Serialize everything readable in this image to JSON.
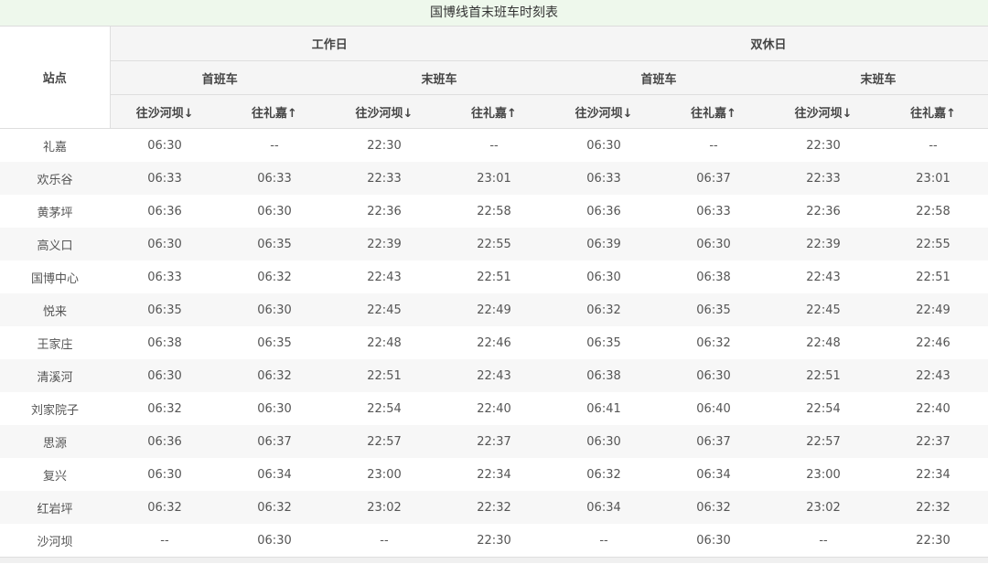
{
  "title": "国博线首末班车时刻表",
  "header": {
    "station": "站点",
    "day_groups": [
      "工作日",
      "双休日"
    ],
    "train_groups": [
      "首班车",
      "末班车",
      "首班车",
      "末班车"
    ],
    "directions": [
      "往沙河坝↓",
      "往礼嘉↑",
      "往沙河坝↓",
      "往礼嘉↑",
      "往沙河坝↓",
      "往礼嘉↑",
      "往沙河坝↓",
      "往礼嘉↑"
    ]
  },
  "rows": [
    {
      "station": "礼嘉",
      "times": [
        "06:30",
        "--",
        "22:30",
        "--",
        "06:30",
        "--",
        "22:30",
        "--"
      ]
    },
    {
      "station": "欢乐谷",
      "times": [
        "06:33",
        "06:33",
        "22:33",
        "23:01",
        "06:33",
        "06:37",
        "22:33",
        "23:01"
      ]
    },
    {
      "station": "黄茅坪",
      "times": [
        "06:36",
        "06:30",
        "22:36",
        "22:58",
        "06:36",
        "06:33",
        "22:36",
        "22:58"
      ]
    },
    {
      "station": "高义口",
      "times": [
        "06:30",
        "06:35",
        "22:39",
        "22:55",
        "06:39",
        "06:30",
        "22:39",
        "22:55"
      ]
    },
    {
      "station": "国博中心",
      "times": [
        "06:33",
        "06:32",
        "22:43",
        "22:51",
        "06:30",
        "06:38",
        "22:43",
        "22:51"
      ]
    },
    {
      "station": "悦来",
      "times": [
        "06:35",
        "06:30",
        "22:45",
        "22:49",
        "06:32",
        "06:35",
        "22:45",
        "22:49"
      ]
    },
    {
      "station": "王家庄",
      "times": [
        "06:38",
        "06:35",
        "22:48",
        "22:46",
        "06:35",
        "06:32",
        "22:48",
        "22:46"
      ]
    },
    {
      "station": "清溪河",
      "times": [
        "06:30",
        "06:32",
        "22:51",
        "22:43",
        "06:38",
        "06:30",
        "22:51",
        "22:43"
      ]
    },
    {
      "station": "刘家院子",
      "times": [
        "06:32",
        "06:30",
        "22:54",
        "22:40",
        "06:41",
        "06:40",
        "22:54",
        "22:40"
      ]
    },
    {
      "station": "思源",
      "times": [
        "06:36",
        "06:37",
        "22:57",
        "22:37",
        "06:30",
        "06:37",
        "22:57",
        "22:37"
      ]
    },
    {
      "station": "复兴",
      "times": [
        "06:30",
        "06:34",
        "23:00",
        "22:34",
        "06:32",
        "06:34",
        "23:00",
        "22:34"
      ]
    },
    {
      "station": "红岩坪",
      "times": [
        "06:32",
        "06:32",
        "23:02",
        "22:32",
        "06:34",
        "06:32",
        "23:02",
        "22:32"
      ]
    },
    {
      "station": "沙河坝",
      "times": [
        "--",
        "06:30",
        "--",
        "22:30",
        "--",
        "06:30",
        "--",
        "22:30"
      ]
    }
  ],
  "colors": {
    "title_bg": "#eef8ec",
    "header_bg": "#f5f5f5",
    "stripe_bg": "#f7f7f7"
  }
}
